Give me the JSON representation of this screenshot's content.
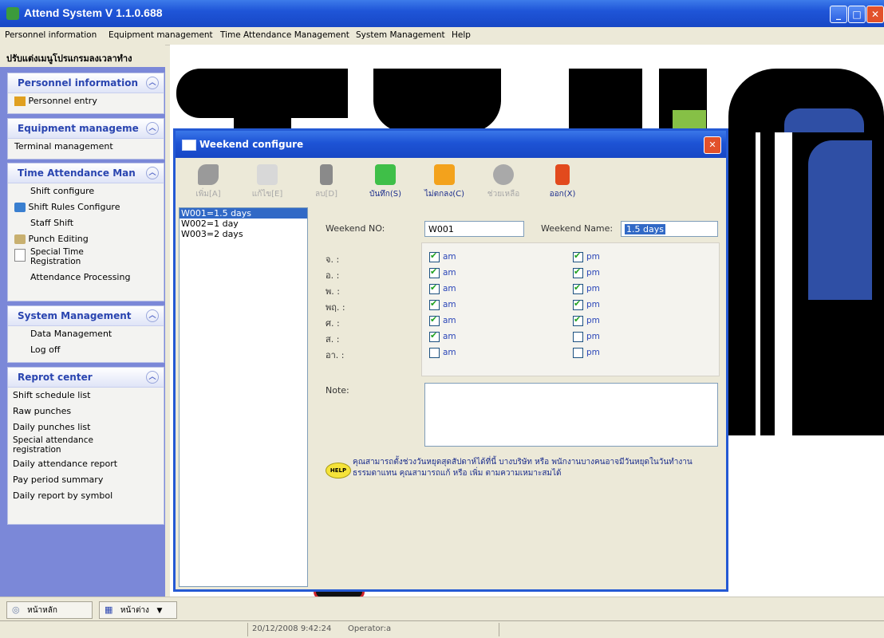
{
  "app": {
    "title": "Attend System V 1.1.0.688",
    "window_controls": [
      "minimize-icon",
      "maximize-icon",
      "close-icon"
    ]
  },
  "menubar": {
    "items": [
      "Personnel information",
      "Equipment management",
      "Time Attendance Management",
      "System Management",
      "Help"
    ]
  },
  "sidebar": {
    "title": "ปรับแต่งเมนูโปรแกรมลงเวลาทำง",
    "groups": [
      {
        "header": "Personnel information",
        "items": [
          "Personnel entry"
        ]
      },
      {
        "header": "Equipment manageme",
        "items": [
          "Terminal management"
        ]
      },
      {
        "header": "Time Attendance Man",
        "items": [
          "Shift configure",
          "Shift Rules Configure",
          "Staff Shift",
          "Punch Editing",
          "Special Time Registration",
          "Attendance Processing"
        ]
      },
      {
        "header": "System Management",
        "items": [
          "Data Management",
          "Log off"
        ]
      },
      {
        "header": "Reprot center",
        "items": [
          "Shift schedule list",
          "Raw punches",
          "Daily punches list",
          "Special attendance registration",
          "Daily attendance report",
          "Pay period summary",
          "Daily report by symbol"
        ]
      }
    ]
  },
  "dialog": {
    "title": "Weekend configure",
    "toolbar": [
      {
        "label": "เพิ่ม[A]",
        "icon": "add-icon",
        "enabled": false
      },
      {
        "label": "แก้ไข[E]",
        "icon": "edit-icon",
        "enabled": false
      },
      {
        "label": "ลบ[D]",
        "icon": "delete-icon",
        "enabled": false
      },
      {
        "label": "บันทึก(S)",
        "icon": "save-icon",
        "enabled": true
      },
      {
        "label": "ไม่ตกลง(C)",
        "icon": "cancel-icon",
        "enabled": true
      },
      {
        "label": "ช่วยเหลือ",
        "icon": "help-icon",
        "enabled": false
      },
      {
        "label": "ออก(X)",
        "icon": "exit-icon",
        "enabled": true
      }
    ],
    "list": {
      "items": [
        "W001=1.5 days",
        "W002=1 day",
        "W003=2 days"
      ],
      "selected": "W001=1.5 days"
    },
    "form": {
      "weekend_no_label": "Weekend NO:",
      "weekend_no_value": "W001",
      "weekend_name_label": "Weekend Name:",
      "weekend_name_value": "1.5 days",
      "days": [
        {
          "day": "จ. :",
          "am": true,
          "pm": true
        },
        {
          "day": "อ. :",
          "am": true,
          "pm": true
        },
        {
          "day": "พ. :",
          "am": true,
          "pm": true
        },
        {
          "day": "พฤ. :",
          "am": true,
          "pm": true
        },
        {
          "day": "ศ. :",
          "am": true,
          "pm": true
        },
        {
          "day": "ส. :",
          "am": true,
          "pm": false
        },
        {
          "day": "อา. :",
          "am": false,
          "pm": false
        }
      ],
      "am_label": "am",
      "pm_label": "pm",
      "note_label": "Note:",
      "note_value": "",
      "help_badge": "HELP",
      "help_text": "คุณสามารถตั้งช่วงวันหยุดสุดสัปดาห์ได้ที่นี้ บางบริษัท หรือ พนักงานบางคนอาจมีวันหยุดในวันทำงานธรรมดาแทน คุณสามารถแก้ หรือ เพิ่ม ตามความเหมาะสมได้"
    }
  },
  "taskbar": {
    "home_label": "หน้าหลัก",
    "window_label": "หน้าต่าง"
  },
  "status": {
    "datetime": "20/12/2008 9:42:24",
    "user": "Operator:a"
  },
  "colors": {
    "titlebar": "#1f55d8",
    "sidebar_bg": "#7b88d8",
    "group_header_text": "#2a45b0",
    "selection": "#3169c6",
    "close_button": "#e2512b"
  }
}
